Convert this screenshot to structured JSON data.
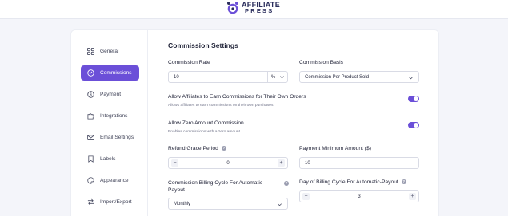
{
  "brand": {
    "line1": "AFFILIATE",
    "line2": "PRESS",
    "accent": "#6b4fd8"
  },
  "sidebar": {
    "items": [
      {
        "label": "General",
        "icon": "grid-icon",
        "active": false
      },
      {
        "label": "Commissions",
        "icon": "percent-circle-icon",
        "active": true
      },
      {
        "label": "Payment",
        "icon": "dollar-circle-icon",
        "active": false
      },
      {
        "label": "Integrations",
        "icon": "puzzle-icon",
        "active": false
      },
      {
        "label": "Email Settings",
        "icon": "mail-icon",
        "active": false
      },
      {
        "label": "Labels",
        "icon": "label-icon",
        "active": false
      },
      {
        "label": "Appearance",
        "icon": "palette-icon",
        "active": false
      },
      {
        "label": "Import/Export",
        "icon": "swap-icon",
        "active": false
      }
    ]
  },
  "main": {
    "title": "Commission Settings",
    "commission_rate": {
      "label": "Commission Rate",
      "value": "10",
      "unit": "%"
    },
    "commission_basis": {
      "label": "Commission Basis",
      "value": "Commission Per Product Sold"
    },
    "own_orders": {
      "label": "Allow Affiliates to Earn Commissions for Their Own Orders",
      "description": "Allows affiliates to earn commissions on their own purchases.",
      "enabled": true
    },
    "zero_amount": {
      "label": "Allow Zero Amount Commission",
      "description": "Enables commissions with a zero amount.",
      "enabled": true
    },
    "grace_period": {
      "label": "Refund Grace Period",
      "value": "0",
      "minus": "−",
      "plus": "+"
    },
    "min_payment": {
      "label": "Payment Minimum Amount ($)",
      "value": "10"
    },
    "billing_cycle": {
      "label": "Commission Billing Cycle For Automatic-Payout",
      "value": "Monthly"
    },
    "billing_day": {
      "label": "Day of Billing Cycle For Automatic-Payout",
      "value": "3",
      "minus": "−",
      "plus": "+"
    }
  }
}
